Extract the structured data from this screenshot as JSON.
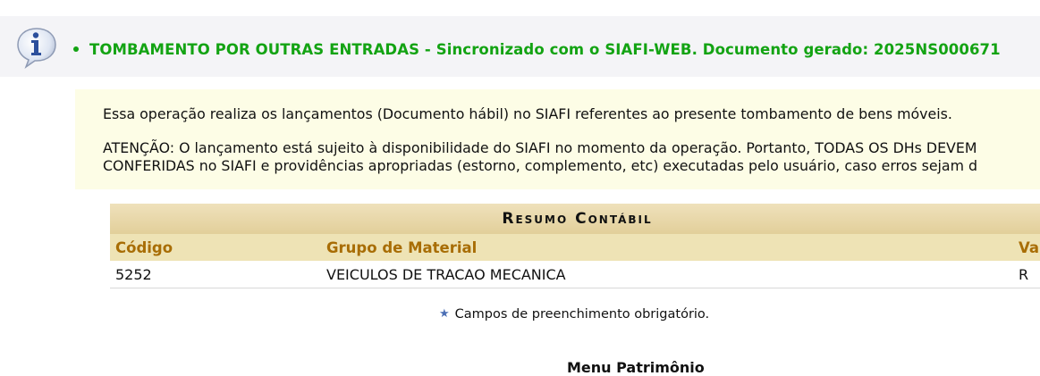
{
  "info_bar": {
    "message": "TOMBAMENTO POR OUTRAS ENTRADAS - Sincronizado com o SIAFI-WEB. Documento gerado: 2025NS000671",
    "icon": "info-icon"
  },
  "notice": {
    "line1": "Essa operação realiza os lançamentos (Documento hábil) no SIAFI referentes ao presente tombamento de bens móveis.",
    "line2": "ATENÇÃO: O lançamento está sujeito à disponibilidade do SIAFI no momento da operação. Portanto, TODAS OS DHs DEVEM",
    "line3": "CONFERIDAS no SIAFI e providências apropriadas (estorno, complemento, etc) executadas pelo usuário, caso erros sejam d"
  },
  "resumo": {
    "caption": "Resumo Contábil",
    "headers": [
      "Código",
      "Grupo de Material",
      "Va"
    ],
    "rows": [
      [
        "5252",
        "VEICULOS DE TRACAO MECANICA",
        "R"
      ]
    ]
  },
  "required_note": "Campos de preenchimento obrigatório.",
  "menu_link": "Menu Patrimônio",
  "colors": {
    "success": "#13a313",
    "header_text": "#a86d05",
    "notice_bg": "#fdfde6"
  }
}
